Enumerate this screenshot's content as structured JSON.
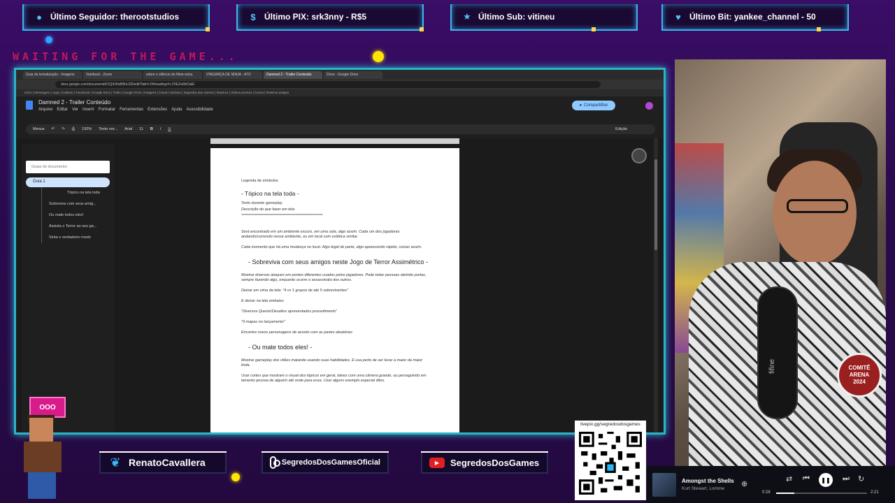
{
  "alerts": [
    {
      "icon": "user-icon",
      "label": "Último Seguidor: therootstudios"
    },
    {
      "icon": "dollar-icon",
      "label": "Último PIX: srk3nny - R$5"
    },
    {
      "icon": "star-icon",
      "label": "Último Sub: vitineu"
    },
    {
      "icon": "heart-icon",
      "label": "Último Bit: yankee_channel - 50"
    }
  ],
  "waiting_text": "WAITING FOR THE GAME...",
  "browser": {
    "tabs": [
      "Guia de tematização - Imagens",
      "Vamburá - Zoom",
      "sobre o silêncio do filme extra",
      "VINGANÇA DE NINJA - ATO",
      "Damned 2 - Trailer Conteúdo",
      "Drive - Google Drive"
    ],
    "active_tab": 4,
    "url": "docs.google.com/document/d/1Q4JhlsB8nL6D/edit?tab=t.0#heading=h.2XEZw0bOaEl",
    "bookmarks": "Início | Mensagem | Apps | Instituto | Facebook | Google Docs | Trello | Google Drive | Imagens | Canal | Notícias | Segredos dos Games | Roteiros | Vídeos prontos | Canva | Roteiros antigos"
  },
  "docs": {
    "title": "Damned 2 - Trailer Conteúdo",
    "menu": [
      "Arquivo",
      "Editar",
      "Ver",
      "Inserir",
      "Formatar",
      "Ferramentas",
      "Extensões",
      "Ajuda",
      "Acessibilidade"
    ],
    "share_label": "Compartilhar",
    "toolbar": {
      "menus": "Menus",
      "zoom": "100%",
      "style": "Texto nor...",
      "font": "Arial",
      "size": "11",
      "editing": "Edição"
    },
    "outline": {
      "search_placeholder": "Guias do documento",
      "tab_label": "Guia 1",
      "items": [
        "Tópico na tela toda",
        "Sobreviva com seus amig...",
        "Ou mate todos eles!",
        "Assista o Terror ao seu ga...",
        "Sinta o verdadeiro medo"
      ]
    },
    "page": {
      "legend": "Legenda de símbolos",
      "topic_heading": "- Tópico na tela toda -",
      "topic_line1": "Texto durante gameplay",
      "topic_line2": "Descrição do que fazer em tela",
      "rule": "================================================",
      "para1": "Será encontrado em um ambiente escuro, em uma sala, algo assim. Cada um dos jogadores andando/correndo nesse ambiente, ou em local com estética similar.",
      "para2": "Cada momento que há uma mudança no local. Algo legal de parte, algo aparecendo rápido, coisas assim.",
      "heading2": "Sobreviva com seus amigos neste Jogo de Terror Assimétrico -",
      "para3": "Mostrar diversos ataques em pontos diferentes usados pelos jogadores. Pode botar pessoas abrindo portas, sempre fazendo algo, enquanto ocorre o assassinato dos outros.",
      "para4": "Deixar em cima da tela: \"4 vs 1 grupos de até 5 sobreviventes\"",
      "para5": "E deixar na tela embaixo",
      "para6": "\"Diversos Quests/Desafios apresentados procedimento\"",
      "para7": "\"9 mapas no lançamento\"",
      "para8": "Encontre novos personagens de acordo com as partes aleatórias",
      "heading3": "Ou mate todos eles! -",
      "para9": "Mostrar gameplay dos vilões matando usando suas habilidades. E usa perto de ser levar a maior da maior linda.",
      "para10": "Usar cortes que mostram o visual dos tópicos em geral, talvez com uma câmera grande, ou perseguindo em lamento pessoa de alguém até onde para essa. Usar alguns exemplo especial ditos."
    }
  },
  "socials": [
    {
      "icon": "twitter-icon",
      "label": "RenatoCavallera"
    },
    {
      "icon": "instagram-icon",
      "label": "SegredosDosGamesOficial"
    },
    {
      "icon": "youtube-icon",
      "label": "SegredosDosGames"
    }
  ],
  "qr": {
    "label": "livepix.gg/segredosdosgames"
  },
  "webcam": {
    "mic_brand": "fifine",
    "badge_line1": "COMITÊ",
    "badge_line2": "ARENA",
    "badge_line3": "2024"
  },
  "pixel_sign": "OOO",
  "player": {
    "title": "Amongst the Shells",
    "artist": "Kurt Stewart, Lomme",
    "elapsed": "0:28",
    "total": "2:21",
    "progress": 0.2
  },
  "colors": {
    "alert_border": "#3bb7e8",
    "frame_border": "#2bb3c8",
    "share_bg": "#8ec9ff",
    "waiting": "#c2185b"
  }
}
